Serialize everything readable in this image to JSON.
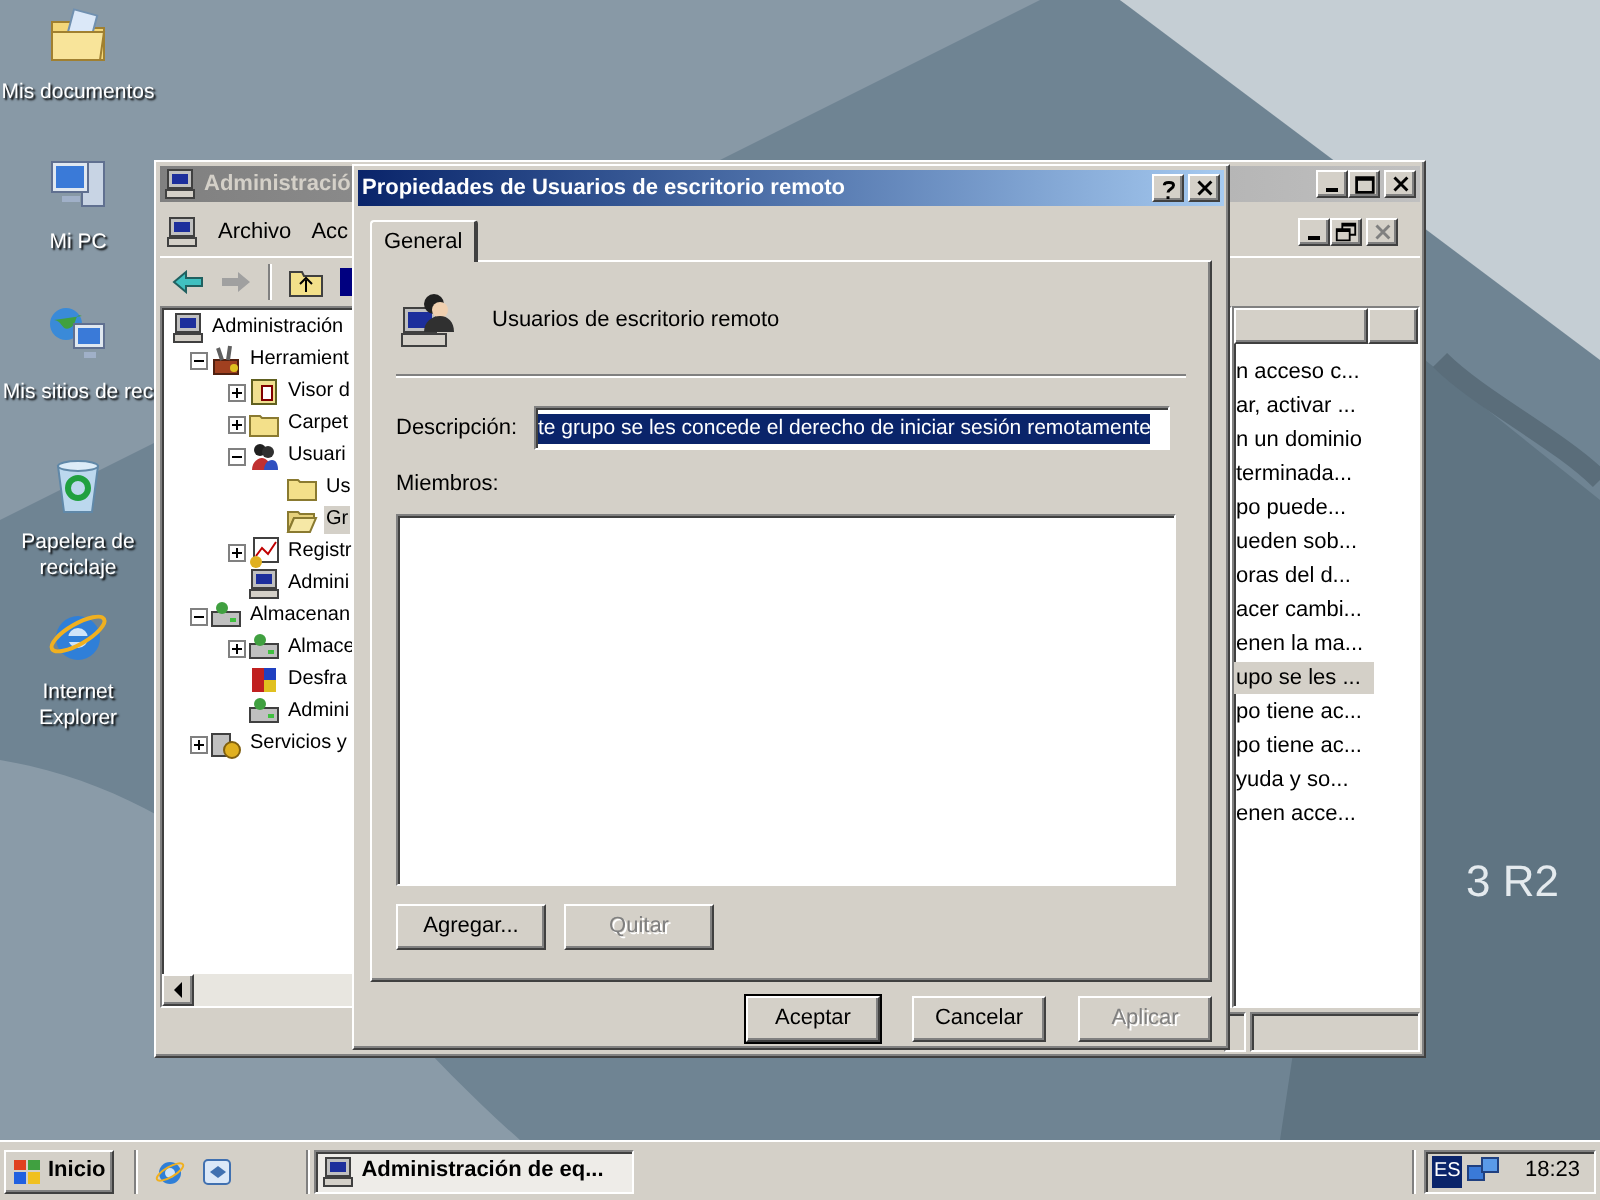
{
  "desktop": {
    "icons": [
      {
        "lines": [
          "Mis documentos"
        ],
        "kind": "folder"
      },
      {
        "lines": [
          "Mi PC"
        ],
        "kind": "computer"
      },
      {
        "lines": [
          "Mis sitios de rec"
        ],
        "kind": "network"
      },
      {
        "lines": [
          "Papelera de",
          "reciclaje"
        ],
        "kind": "recycle"
      },
      {
        "lines": [
          "Internet",
          "Explorer"
        ],
        "kind": "ie"
      }
    ],
    "wallpaper_text": "3 R2"
  },
  "back_window": {
    "title": "Administració",
    "menu": [
      "Archivo",
      "Acc"
    ],
    "tree": [
      {
        "label": "Administración",
        "kind": "computer",
        "selected": false,
        "children": [
          {
            "label": "Herramient",
            "kind": "tools",
            "expanded": true,
            "selected": false,
            "children": [
              {
                "label": "Visor d",
                "kind": "log",
                "expanded": false,
                "selected": false
              },
              {
                "label": "Carpet",
                "kind": "folder",
                "expanded": false,
                "selected": false
              },
              {
                "label": "Usuari",
                "kind": "users",
                "expanded": true,
                "selected": false,
                "children": [
                  {
                    "label": "Us",
                    "kind": "folder",
                    "selected": false
                  },
                  {
                    "label": "Gr",
                    "kind": "openfolder",
                    "selected": true
                  }
                ]
              },
              {
                "label": "Registr",
                "kind": "chart",
                "expanded": false,
                "selected": false
              },
              {
                "label": "Admini",
                "kind": "computer",
                "selected": false
              }
            ]
          },
          {
            "label": "Almacenan",
            "kind": "drive",
            "expanded": true,
            "selected": false,
            "children": [
              {
                "label": "Almace",
                "kind": "drive",
                "expanded": false,
                "selected": false
              },
              {
                "label": "Desfra",
                "kind": "defrag",
                "selected": false
              },
              {
                "label": "Admini",
                "kind": "drive",
                "selected": false
              }
            ]
          },
          {
            "label": "Servicios y",
            "kind": "services",
            "expanded": false,
            "selected": false
          }
        ]
      }
    ],
    "list_items": [
      {
        "text": "n acceso c...",
        "selected": false
      },
      {
        "text": "ar, activar ...",
        "selected": false
      },
      {
        "text": "n un dominio",
        "selected": false
      },
      {
        "text": "terminada...",
        "selected": false
      },
      {
        "text": "po puede...",
        "selected": false
      },
      {
        "text": "ueden sob...",
        "selected": false
      },
      {
        "text": "oras del d...",
        "selected": false
      },
      {
        "text": "acer cambi...",
        "selected": false
      },
      {
        "text": "enen la ma...",
        "selected": false
      },
      {
        "text": "upo se les ...",
        "selected": true
      },
      {
        "text": "po tiene ac...",
        "selected": false
      },
      {
        "text": "po tiene ac...",
        "selected": false
      },
      {
        "text": "yuda y so...",
        "selected": false
      },
      {
        "text": "enen acce...",
        "selected": false
      }
    ]
  },
  "dialog": {
    "title": "Propiedades de Usuarios de escritorio remoto",
    "tabs": [
      {
        "label": "General",
        "selected": true
      }
    ],
    "group_name": "Usuarios de escritorio remoto",
    "description_label": "Descripción:",
    "description": {
      "value": "te grupo se les concede el derecho de iniciar sesión remotamente",
      "text_selected": true
    },
    "members_label": "Miembros:",
    "member_buttons": [
      {
        "label": "Agregar...",
        "disabled": false
      },
      {
        "label": "Quitar",
        "disabled": true
      }
    ],
    "footer_buttons": [
      {
        "label": "Aceptar",
        "disabled": false
      },
      {
        "label": "Cancelar",
        "disabled": false
      },
      {
        "label": "Aplicar",
        "disabled": true
      }
    ]
  },
  "taskbar": {
    "start": "Inicio",
    "tasks": [
      {
        "label": "Administración de eq...",
        "selected": true
      }
    ],
    "language": "ES",
    "clock": "18:23"
  }
}
